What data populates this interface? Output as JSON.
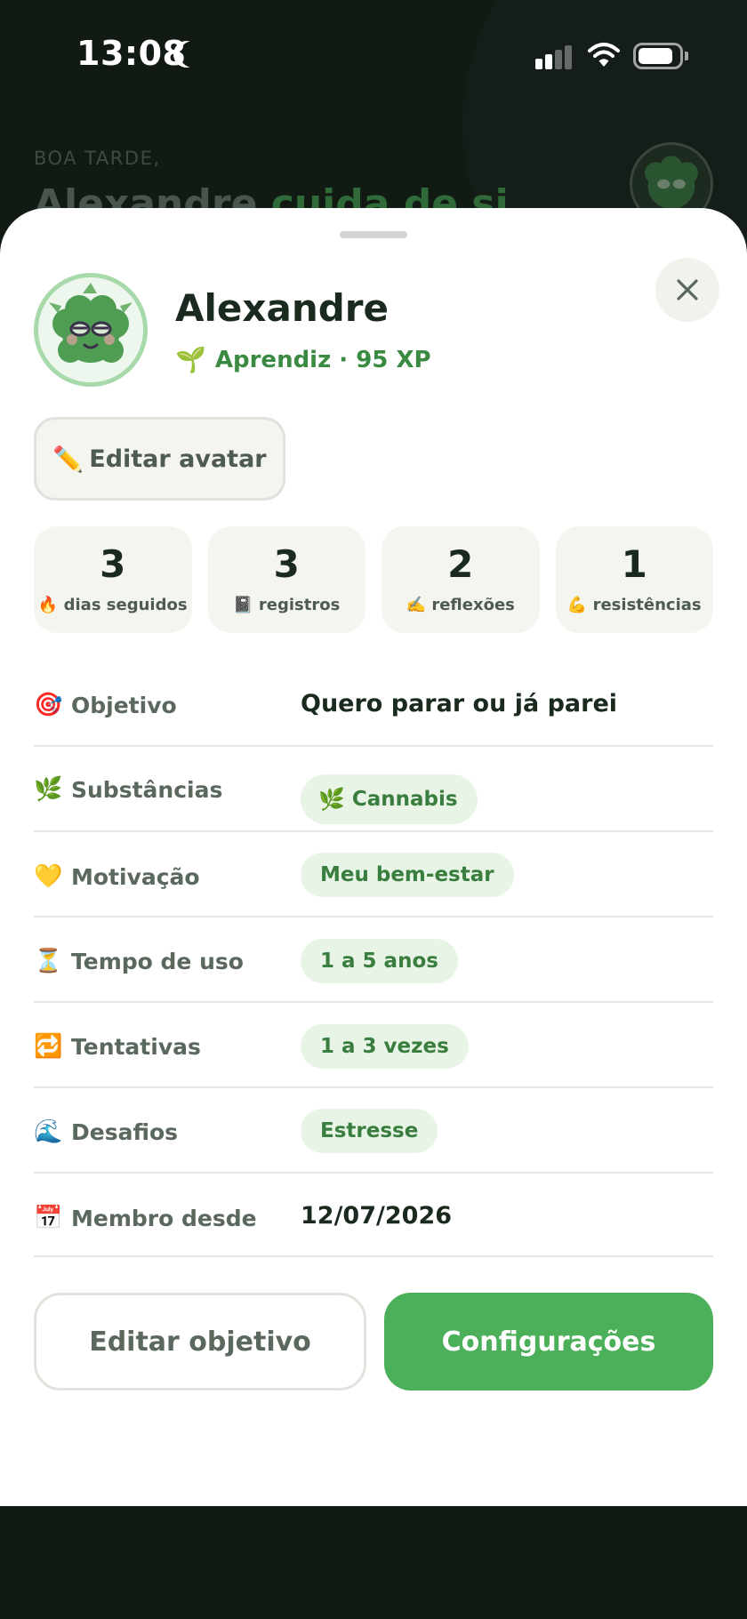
{
  "status_bar": {
    "time": "13:08"
  },
  "background": {
    "greeting": "BOA TARDE,",
    "title_name": "Alexandre",
    "title_accent": "cuida de si"
  },
  "profile": {
    "name": "Alexandre",
    "level": "Aprendiz · 95 XP",
    "level_icon": "🌱",
    "edit_avatar_label": "Editar avatar",
    "edit_avatar_icon": "✏️"
  },
  "stats": [
    {
      "value": "3",
      "icon": "🔥",
      "label": "dias seguidos"
    },
    {
      "value": "3",
      "icon": "📓",
      "label": "registros"
    },
    {
      "value": "2",
      "icon": "✍️",
      "label": "reflexões"
    },
    {
      "value": "1",
      "icon": "💪",
      "label": "resistências"
    }
  ],
  "details": {
    "objetivo": {
      "icon": "🎯",
      "label": "Objetivo",
      "value": "Quero parar ou já parei"
    },
    "substancias": {
      "icon": "🌿",
      "label": "Substâncias",
      "chip_icon": "🌿",
      "value": "Cannabis"
    },
    "motivacao": {
      "icon": "💛",
      "label": "Motivação",
      "value": "Meu bem-estar"
    },
    "tempo": {
      "icon": "⏳",
      "label": "Tempo de uso",
      "value": "1 a 5 anos"
    },
    "tentativas": {
      "icon": "🔁",
      "label": "Tentativas",
      "value": "1 a 3 vezes"
    },
    "desafios": {
      "icon": "🌊",
      "label": "Desafios",
      "value": "Estresse"
    },
    "membro": {
      "icon": "📅",
      "label": "Membro desde",
      "value": "12/07/2026"
    }
  },
  "actions": {
    "edit_goal": "Editar objetivo",
    "settings": "Configurações"
  },
  "colors": {
    "accent": "#4caf5a",
    "chip_bg": "#e8f5e6",
    "chip_text": "#3a7e3f",
    "dark_bg": "#121a14"
  }
}
